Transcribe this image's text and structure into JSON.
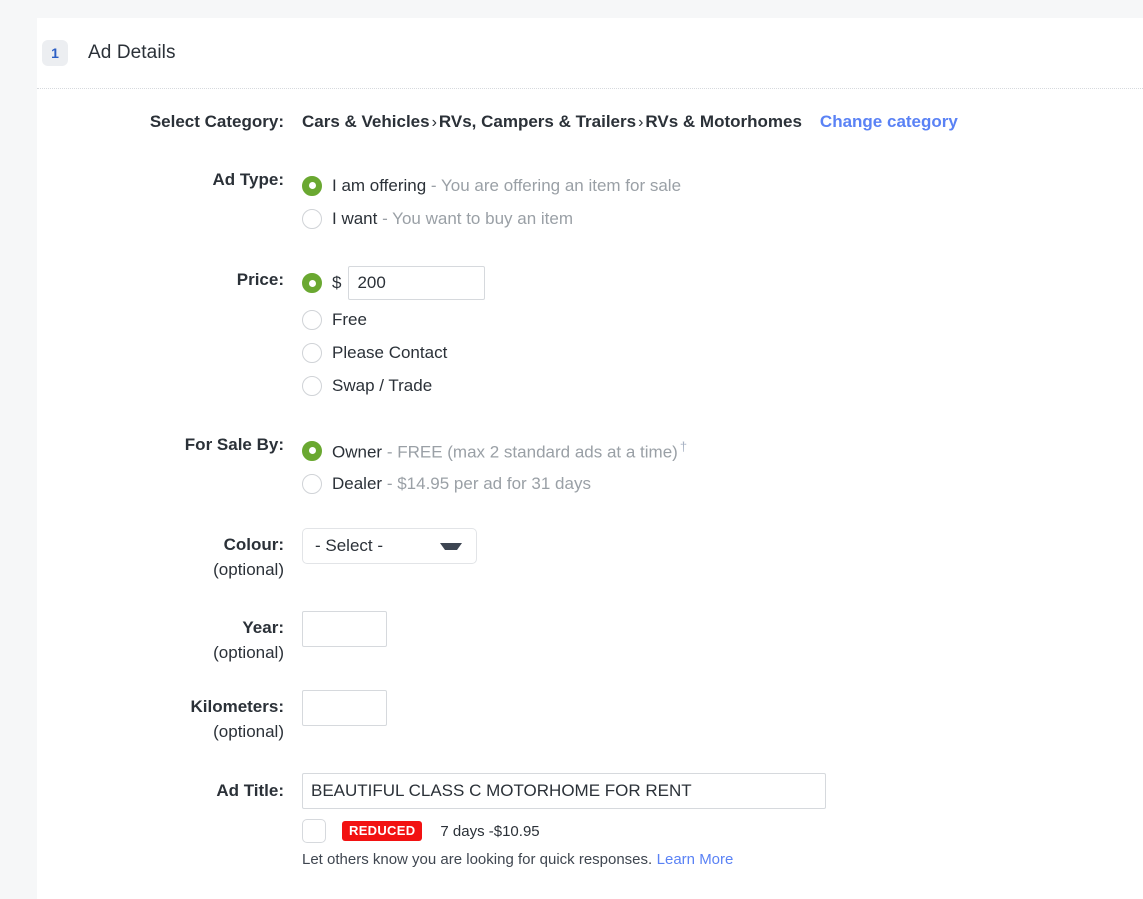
{
  "section": {
    "step_number": "1",
    "title": "Ad Details"
  },
  "category": {
    "label": "Select Category:",
    "path": [
      "Cars & Vehicles",
      "RVs, Campers & Trailers",
      "RVs & Motorhomes"
    ],
    "separator": "›",
    "change_link": "Change category"
  },
  "ad_type": {
    "label": "Ad Type:",
    "options": [
      {
        "label": "I am offering",
        "desc": "- You are offering an item for sale",
        "selected": true
      },
      {
        "label": "I want",
        "desc": "- You want to buy an item",
        "selected": false
      }
    ]
  },
  "price": {
    "label": "Price:",
    "currency_symbol": "$",
    "value": "200",
    "placeholder": "",
    "options": [
      {
        "label": "Free",
        "selected": false
      },
      {
        "label": "Please Contact",
        "selected": false
      },
      {
        "label": "Swap / Trade",
        "selected": false
      }
    ]
  },
  "for_sale_by": {
    "label": "For Sale By:",
    "options": [
      {
        "label": "Owner",
        "desc": "- FREE (max 2 standard ads at a time)",
        "dagger": "†",
        "selected": true
      },
      {
        "label": "Dealer",
        "desc": "- $14.95 per ad for 31 days",
        "dagger": "",
        "selected": false
      }
    ]
  },
  "colour": {
    "label": "Colour:",
    "sub_label": "(optional)",
    "selected": "- Select -",
    "options": [
      "- Select -"
    ]
  },
  "year": {
    "label": "Year:",
    "sub_label": "(optional)",
    "value": "",
    "placeholder": ""
  },
  "kilometers": {
    "label": "Kilometers:",
    "sub_label": "(optional)",
    "value": "",
    "placeholder": ""
  },
  "ad_title": {
    "label": "Ad Title:",
    "value": "BEAUTIFUL CLASS C MOTORHOME FOR RENT",
    "placeholder": ""
  },
  "promo": {
    "badge": "REDUCED",
    "duration_price": "7 days -$10.95",
    "note": "Let others know you are looking for quick responses.",
    "learn_more": "Learn More"
  },
  "colors": {
    "accent_green": "#6aa831",
    "link_blue": "#5a82f5",
    "badge_red": "#f21212",
    "step_blue": "#2d5fc4",
    "page_bg": "#f6f7f8"
  }
}
